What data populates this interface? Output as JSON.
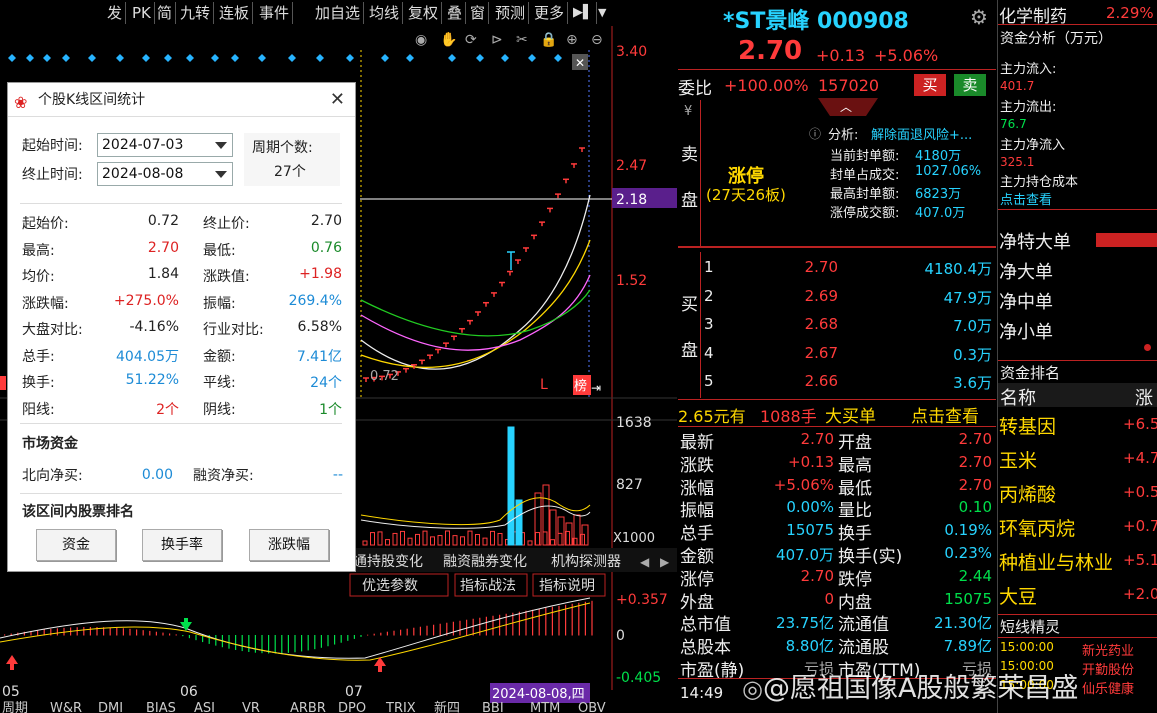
{
  "toolbar": {
    "items": [
      "发",
      "PK",
      "简",
      "九转",
      "连板",
      "事件",
      "加自选",
      "均线",
      "复权",
      "叠",
      "窗",
      "预测",
      "更多"
    ]
  },
  "chart": {
    "price_ticks": [
      "3.40",
      "2.47",
      "2.18",
      "1.52"
    ],
    "low_label": "0.72",
    "vol_ticks": [
      "1638",
      "827",
      "X1000"
    ],
    "tabs": [
      "通持股变化",
      "融资融券变化",
      "机构探测器"
    ],
    "macd_buttons": [
      "优选参数",
      "指标战法",
      "指标说明"
    ],
    "macd_ticks": [
      "+0.357",
      "0",
      "-0.405"
    ],
    "months": [
      "05",
      "06",
      "07"
    ],
    "date_cursor": "2024-08-08,四",
    "bottom_tabs": [
      "周期",
      "W&R",
      "DMI",
      "BIAS",
      "ASI",
      "VR",
      "ARBR",
      "DPO",
      "TRIX",
      "新四",
      "BBI",
      "MTM",
      "OBV"
    ],
    "marker_L": "L",
    "marker_side": "榜"
  },
  "dialog": {
    "title": "个股K线区间统计",
    "start_label": "起始时间:",
    "start_value": "2024-07-03",
    "end_label": "终止时间:",
    "end_value": "2024-08-08",
    "period_label": "周期个数:",
    "period_value": "27个",
    "stats": [
      [
        "起始价:",
        "0.72",
        "终止价:",
        "2.70"
      ],
      [
        "最高:",
        "2.70",
        "最低:",
        "0.76"
      ],
      [
        "均价:",
        "1.84",
        "涨跌值:",
        "+1.98"
      ],
      [
        "涨跌幅:",
        "+275.0%",
        "振幅:",
        "269.4%"
      ],
      [
        "大盘对比:",
        "-4.16%",
        "行业对比:",
        "6.58%"
      ],
      [
        "总手:",
        "404.05万",
        "金额:",
        "7.41亿"
      ],
      [
        "换手:",
        "51.22%",
        "平线:",
        "24个"
      ],
      [
        "阳线:",
        "2个",
        "阴线:",
        "1个"
      ]
    ],
    "market_section": "市场资金",
    "north_label": "北向净买:",
    "north_value": "0.00",
    "margin_label": "融资净买:",
    "margin_value": "--",
    "rank_section": "该区间内股票排名",
    "buttons": [
      "资金",
      "换手率",
      "涨跌幅"
    ]
  },
  "quote": {
    "name": "*ST景峰 000908",
    "price": "2.70",
    "change": "+0.13",
    "pct": "+5.06%",
    "weibi_label": "委比",
    "weibi": "+100.00%",
    "weicha": "157020",
    "buy_btn": "买",
    "sell_btn": "卖",
    "sell_side": [
      "卖",
      "盘"
    ],
    "limit_up": "涨停",
    "limit_sub": "(27天26板)",
    "analysis_label": "分析:",
    "analysis_text": "解除面退风险+...",
    "seal_rows": [
      [
        "当前封单额:",
        "4180万"
      ],
      [
        "封单占成交:",
        "1027.06%"
      ],
      [
        "最高封单额:",
        "6823万"
      ],
      [
        "涨停成交额:",
        "407.0万"
      ]
    ],
    "buy_side": [
      "买",
      "盘"
    ],
    "bids": [
      [
        "1",
        "2.70",
        "4180.4万"
      ],
      [
        "2",
        "2.69",
        "47.9万"
      ],
      [
        "3",
        "2.68",
        "7.0万"
      ],
      [
        "4",
        "2.67",
        "0.3万"
      ],
      [
        "5",
        "2.66",
        "3.6万"
      ]
    ],
    "big_buy": "2.65元有",
    "big_buy_qty": "1088手",
    "big_buy_label": "大买单",
    "big_buy_link": "点击查看",
    "fields": [
      [
        "最新",
        "2.70",
        "开盘",
        "2.70"
      ],
      [
        "涨跌",
        "+0.13",
        "最高",
        "2.70"
      ],
      [
        "涨幅",
        "+5.06%",
        "最低",
        "2.70"
      ],
      [
        "振幅",
        "0.00%",
        "量比",
        "0.10"
      ],
      [
        "总手",
        "15075",
        "换手",
        "0.19%"
      ],
      [
        "金额",
        "407.0万",
        "换手(实)",
        "0.23%"
      ],
      [
        "涨停",
        "2.70",
        "跌停",
        "2.44"
      ],
      [
        "外盘",
        "0",
        "内盘",
        "15075"
      ],
      [
        "总市值",
        "23.75亿",
        "流通值",
        "21.30亿"
      ],
      [
        "总股本",
        "8.80亿",
        "流通股",
        "7.89亿"
      ],
      [
        "市盈(静)",
        "亏损",
        "市盈(TTM)",
        "亏损"
      ]
    ],
    "time": "14:49"
  },
  "far": {
    "sector": "化学制药",
    "sector_pct": "2.29%",
    "fund_title": "资金分析（万元）",
    "fund_rows": [
      [
        "主力流入:",
        "401.7"
      ],
      [
        "主力流出:",
        "76.7"
      ],
      [
        "主力净流入",
        "325.1"
      ]
    ],
    "hold_cost": "主力持仓成本",
    "click": "点击查看",
    "net_rows": [
      "净特大单",
      "净大单",
      "净中单",
      "净小单"
    ],
    "rank_title": "资金排名",
    "rank_head": [
      "名称",
      "涨"
    ],
    "rank_rows": [
      [
        "转基因",
        "+6.5"
      ],
      [
        "玉米",
        "+4.7"
      ],
      [
        "丙烯酸",
        "+0.5"
      ],
      [
        "环氧丙烷",
        "+0.7"
      ],
      [
        "种植业与林业",
        "+5.1"
      ],
      [
        "大豆",
        "+2.0"
      ]
    ],
    "news_title": "短线精灵",
    "news": [
      [
        "15:00:00",
        "新光药业"
      ],
      [
        "15:00:00",
        "开勤股份"
      ],
      [
        "15:00:00",
        "仙乐健康"
      ]
    ]
  },
  "watermark": "@愿祖国像A股般繁荣昌盛"
}
